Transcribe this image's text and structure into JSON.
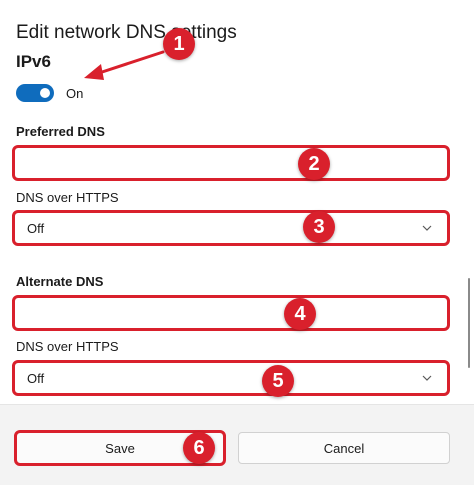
{
  "dialog": {
    "title": "Edit network DNS settings"
  },
  "ipv6": {
    "heading": "IPv6",
    "toggle_state": "On",
    "toggle_on": true
  },
  "preferred_dns": {
    "label": "Preferred DNS",
    "value": "",
    "https_label": "DNS over HTTPS",
    "https_value": "Off"
  },
  "alternate_dns": {
    "label": "Alternate DNS",
    "value": "",
    "https_label": "DNS over HTTPS",
    "https_value": "Off"
  },
  "footer": {
    "save_label": "Save",
    "cancel_label": "Cancel"
  },
  "annotations": {
    "badge_1": "1",
    "badge_2": "2",
    "badge_3": "3",
    "badge_4": "4",
    "badge_5": "5",
    "badge_6": "6",
    "color": "#d9202c"
  },
  "colors": {
    "accent": "#0f6cbd",
    "highlight": "#d9202c"
  },
  "icons": {
    "select_chevron": "chevron-down-icon"
  }
}
